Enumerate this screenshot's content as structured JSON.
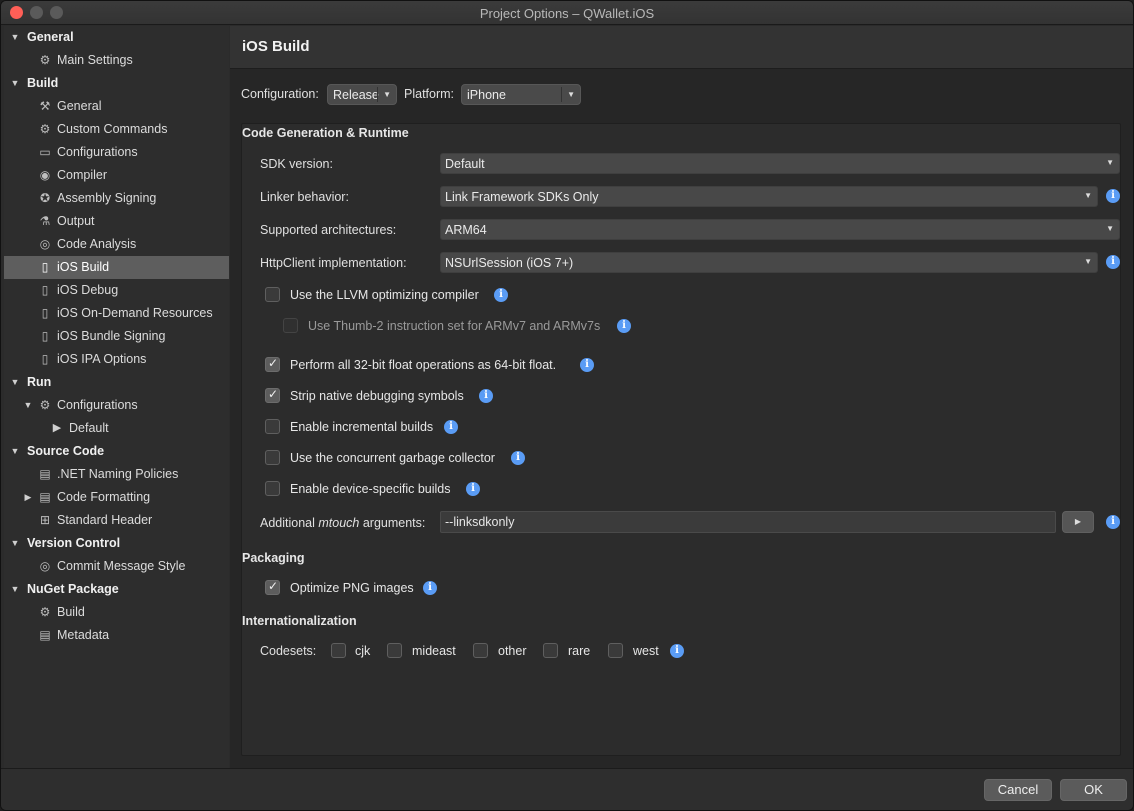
{
  "window": {
    "title": "Project Options – QWallet.iOS"
  },
  "sidebar": {
    "general_section": "General",
    "main_settings": "Main Settings",
    "build_section": "Build",
    "build_general": "General",
    "custom_commands": "Custom Commands",
    "configurations": "Configurations",
    "compiler": "Compiler",
    "assembly_signing": "Assembly Signing",
    "output": "Output",
    "code_analysis": "Code Analysis",
    "ios_build": "iOS Build",
    "ios_debug": "iOS Debug",
    "ios_on_demand": "iOS On-Demand Resources",
    "ios_bundle_signing": "iOS Bundle Signing",
    "ios_ipa_options": "iOS IPA Options",
    "run_section": "Run",
    "run_configurations": "Configurations",
    "run_default": "Default",
    "source_code_section": "Source Code",
    "net_naming": ".NET Naming Policies",
    "code_formatting": "Code Formatting",
    "standard_header": "Standard Header",
    "version_control_section": "Version Control",
    "commit_message_style": "Commit Message Style",
    "nuget_section": "NuGet Package",
    "nuget_build": "Build",
    "metadata": "Metadata"
  },
  "content": {
    "title": "iOS Build",
    "configuration_label": "Configuration:",
    "configuration_value": "Release",
    "platform_label": "Platform:",
    "platform_value": "iPhone",
    "codegen_heading": "Code Generation & Runtime",
    "sdk_label": "SDK version:",
    "sdk_value": "Default",
    "linker_label": "Linker behavior:",
    "linker_value": "Link Framework SDKs Only",
    "arch_label": "Supported architectures:",
    "arch_value": "ARM64",
    "httpclient_label": "HttpClient implementation:",
    "httpclient_value": "NSUrlSession (iOS 7+)",
    "llvm_label": "Use the LLVM optimizing compiler",
    "llvm_checked": false,
    "thumb_label": "Use Thumb-2 instruction set for ARMv7 and ARMv7s",
    "thumb_checked": false,
    "float_label": "Perform all 32-bit float operations as 64-bit float.",
    "float_checked": true,
    "strip_label": "Strip native debugging symbols",
    "strip_checked": true,
    "incremental_label": "Enable incremental builds",
    "incremental_checked": false,
    "gc_label": "Use the concurrent garbage collector",
    "gc_checked": false,
    "device_label": "Enable device-specific builds",
    "device_checked": false,
    "mtouch_label_prefix": "Additional ",
    "mtouch_label_em": "mtouch",
    "mtouch_label_suffix": " arguments:",
    "mtouch_value": "--linksdkonly",
    "packaging_heading": "Packaging",
    "png_label": "Optimize PNG images",
    "png_checked": true,
    "i18n_heading": "Internationalization",
    "codesets_label": "Codesets:",
    "codeset_cjk": "cjk",
    "codeset_mideast": "mideast",
    "codeset_other": "other",
    "codeset_rare": "rare",
    "codeset_west": "west"
  },
  "footer": {
    "cancel": "Cancel",
    "ok": "OK"
  },
  "icons": {
    "info": "info-icon",
    "dropdown": "chevron-down-icon",
    "run": "play-icon"
  },
  "colors": {
    "info_blue": "#5a9cf5",
    "selected_row": "#5e5e5e",
    "close_red": "#ff5f57"
  }
}
